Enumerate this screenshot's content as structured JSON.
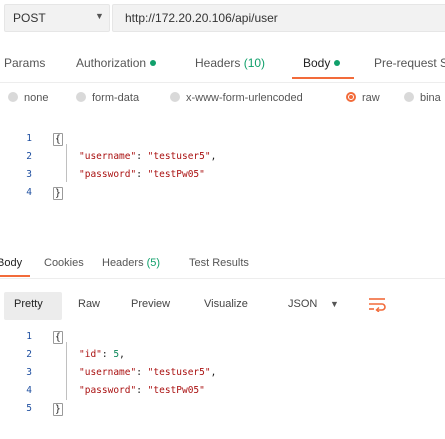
{
  "request": {
    "method": "POST",
    "url": "http://172.20.20.106/api/user"
  },
  "request_tabs": {
    "params": "Params",
    "authorization": "Authorization",
    "headers": "Headers",
    "headers_count": "(10)",
    "body": "Body",
    "prerequest": "Pre-request S"
  },
  "body_modes": {
    "none": "none",
    "form_data": "form-data",
    "urlencoded": "x-www-form-urlencoded",
    "raw": "raw",
    "binary": "bina",
    "selected": "raw"
  },
  "request_body": {
    "lines": [
      {
        "n": "1",
        "text": "{"
      },
      {
        "n": "2",
        "key": "\"username\"",
        "value": "\"testuser5\"",
        "trail": ","
      },
      {
        "n": "3",
        "key": "\"password\"",
        "value": "\"testPw05\"",
        "trail": ""
      },
      {
        "n": "4",
        "text": "}"
      }
    ]
  },
  "response_tabs": {
    "body": "Body",
    "cookies": "Cookies",
    "headers": "Headers",
    "headers_count": "(5)",
    "test_results": "Test Results"
  },
  "view_bar": {
    "pretty": "Pretty",
    "raw": "Raw",
    "preview": "Preview",
    "visualize": "Visualize",
    "format": "JSON"
  },
  "response_body": {
    "lines": [
      {
        "n": "1",
        "text": "{"
      },
      {
        "n": "2",
        "key": "\"id\"",
        "value": "5",
        "trail": ","
      },
      {
        "n": "3",
        "key": "\"username\"",
        "value": "\"testuser5\"",
        "trail": ","
      },
      {
        "n": "4",
        "key": "\"password\"",
        "value": "\"testPw05\"",
        "trail": ""
      },
      {
        "n": "5",
        "text": "}"
      }
    ]
  },
  "colors": {
    "accent": "#f26b3a",
    "status_green": "#10a06b"
  },
  "icons": {
    "method_dropdown": "chevron-down-icon",
    "format_dropdown": "chevron-down-icon",
    "wrap": "wrap-lines-icon"
  }
}
